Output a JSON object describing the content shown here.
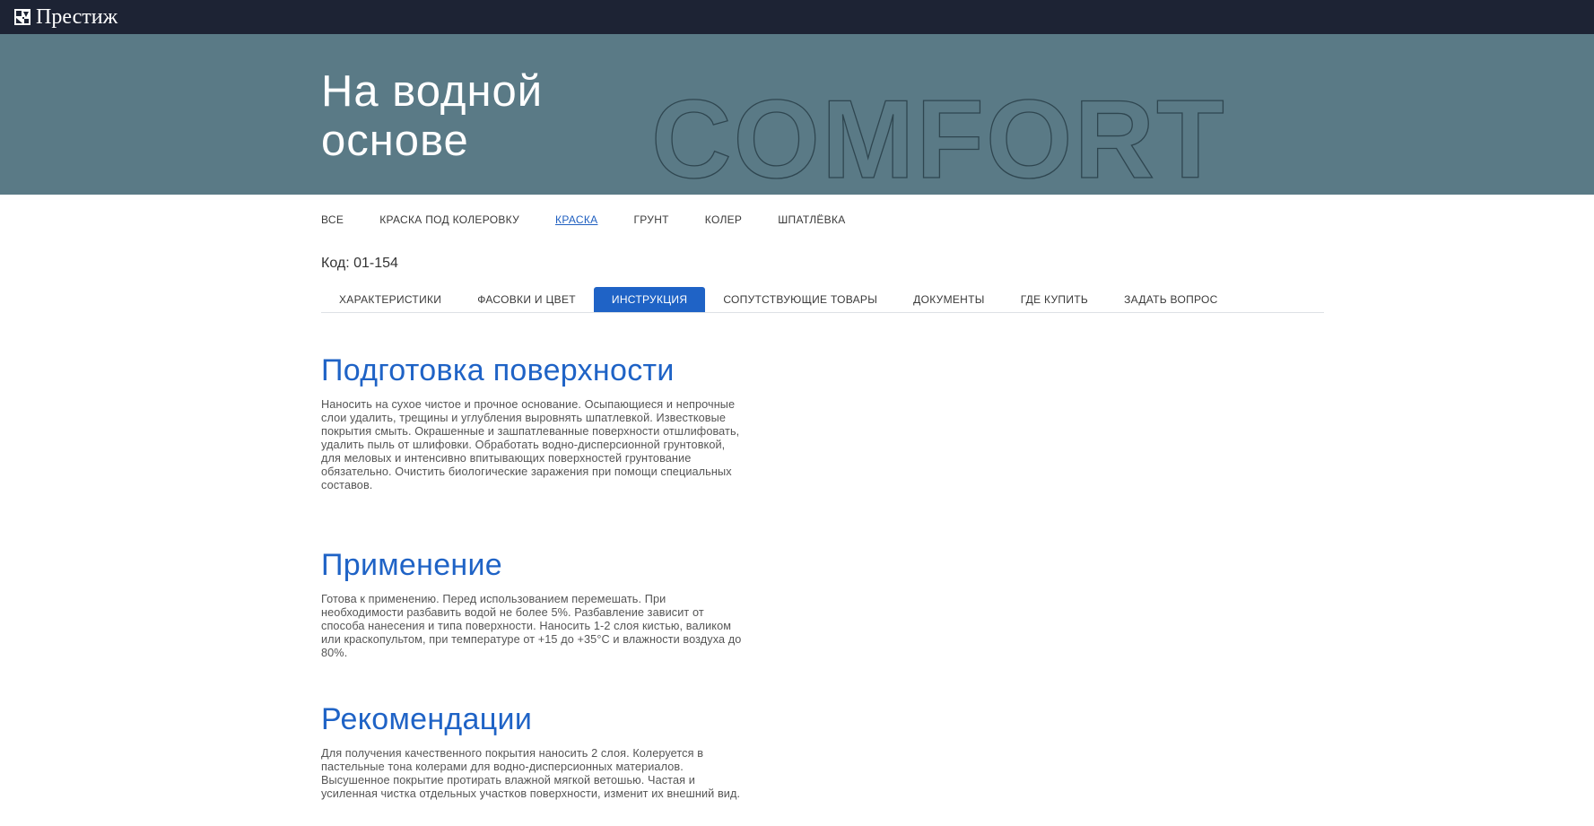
{
  "brand": {
    "name": "Престиж"
  },
  "hero": {
    "title_line1": "На водной",
    "title_line2": "основе",
    "watermark": "COMFORT"
  },
  "category_nav": {
    "items": [
      {
        "label": "ВСЕ",
        "active": false
      },
      {
        "label": "КРАСКА ПОД КОЛЕРОВКУ",
        "active": false
      },
      {
        "label": "КРАСКА",
        "active": true
      },
      {
        "label": "ГРУНТ",
        "active": false
      },
      {
        "label": "КОЛЕР",
        "active": false
      },
      {
        "label": "ШПАТЛЁВКА",
        "active": false
      }
    ]
  },
  "product": {
    "code": "Код: 01-154"
  },
  "tabs": [
    {
      "label": "ХАРАКТЕРИСТИКИ",
      "active": false
    },
    {
      "label": "ФАСОВКИ И ЦВЕТ",
      "active": false
    },
    {
      "label": "ИНСТРУКЦИЯ",
      "active": true
    },
    {
      "label": "СОПУТСТВУЮЩИЕ ТОВАРЫ",
      "active": false
    },
    {
      "label": "ДОКУМЕНТЫ",
      "active": false
    },
    {
      "label": "ГДЕ КУПИТЬ",
      "active": false
    },
    {
      "label": "ЗАДАТЬ ВОПРОС",
      "active": false
    }
  ],
  "sections": [
    {
      "title": "Подготовка поверхности",
      "text": "Наносить на сухое чистое и прочное основание. Осыпающиеся и непрочные слои удалить, трещины и углубления выровнять шпатлевкой. Известковые покрытия смыть. Окрашенные и зашпатлеванные поверхности отшлифовать, удалить пыль от шлифовки. Обработать водно-дисперсионной грунтовкой, для меловых и интенсивно впитывающих поверхностей грунтование обязательно. Очистить биологические заражения при помощи специальных составов."
    },
    {
      "title": "Применение",
      "text": "Готова к применению. Перед использованием перемешать. При необходимости разбавить водой не более 5%. Разбавление зависит от способа нанесения и типа поверхности. Наносить 1-2 слоя кистью, валиком или краскопультом, при температуре от +15 до +35°С и влажности воздуха до 80%."
    },
    {
      "title": "Рекомендации",
      "text": "Для получения качественного покрытия наносить 2 слоя. Колеруется в пастельные тона колерами для водно-дисперсионных материалов. Высушенное покрытие протирать влажной мягкой ветошью. Частая и усиленная чистка отдельных участков поверхности, изменит их внешний вид."
    }
  ],
  "colors": {
    "topbar": "#1d2334",
    "hero": "#5a7a86",
    "accent": "#1f63c6",
    "text": "#555555"
  }
}
